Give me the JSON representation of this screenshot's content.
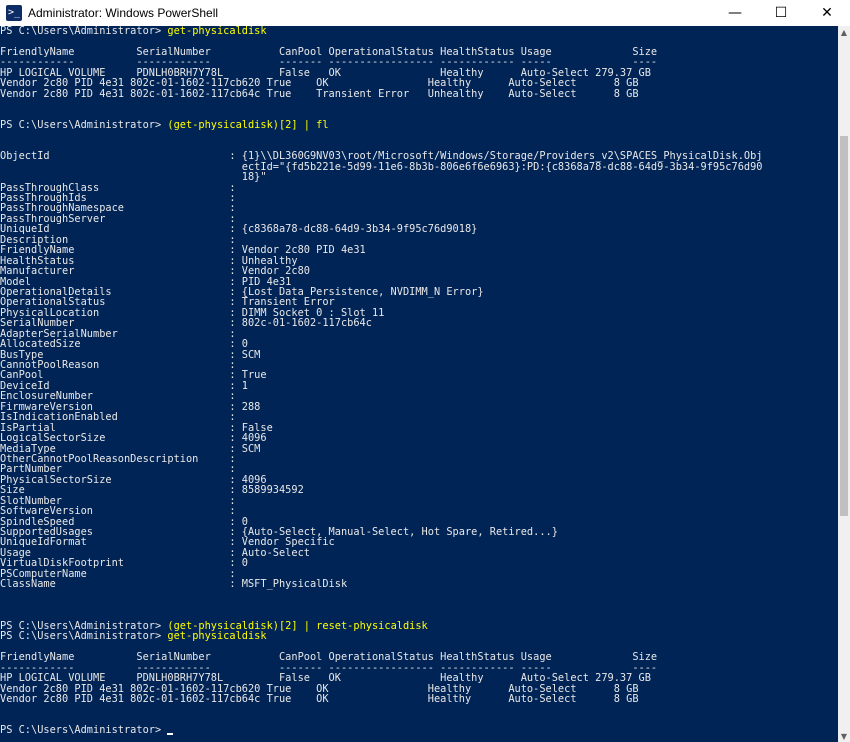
{
  "window": {
    "title": "Administrator: Windows PowerShell",
    "icon": "powershell-icon",
    "controls": {
      "minimize": "—",
      "maximize": "☐",
      "close": "✕"
    }
  },
  "console": {
    "lines": [
      [
        {
          "t": "PS C:\\Users\\Administrator> "
        },
        {
          "t": "get-physicaldisk",
          "c": "y"
        }
      ],
      [
        {
          "t": ""
        }
      ],
      [
        {
          "t": "FriendlyName          SerialNumber           CanPool OperationalStatus HealthStatus Usage             Size"
        }
      ],
      [
        {
          "t": "------------          ------------           ------- ----------------- ------------ -----             ----"
        }
      ],
      [
        {
          "t": "HP LOGICAL VOLUME     PDNLH0BRH7Y78L         False   OK                Healthy      Auto-Select 279.37 GB"
        }
      ],
      [
        {
          "t": "Vendor 2c80 PID 4e31 802c-01-1602-117cb620 True    OK                Healthy      Auto-Select      8 GB"
        }
      ],
      [
        {
          "t": "Vendor 2c80 PID 4e31 802c-01-1602-117cb64c True    Transient Error   Unhealthy    Auto-Select      8 GB"
        }
      ],
      [
        {
          "t": ""
        }
      ],
      [
        {
          "t": ""
        }
      ],
      [
        {
          "t": "PS C:\\Users\\Administrator> "
        },
        {
          "t": "(get-physicaldisk)[2] | fl",
          "c": "y"
        }
      ],
      [
        {
          "t": ""
        }
      ],
      [
        {
          "t": ""
        }
      ],
      [
        {
          "t": "ObjectId                             : {1}\\\\DL360G9NV03\\root/Microsoft/Windows/Storage/Providers_v2\\SPACES_PhysicalDisk.Obj"
        }
      ],
      [
        {
          "t": "                                       ectId=\"{fd5b221e-5d99-11e6-8b3b-806e6f6e6963}:PD:{c8368a78-dc88-64d9-3b34-9f95c76d90"
        }
      ],
      [
        {
          "t": "                                       18}\""
        }
      ],
      [
        {
          "t": "PassThroughClass                     :"
        }
      ],
      [
        {
          "t": "PassThroughIds                       :"
        }
      ],
      [
        {
          "t": "PassThroughNamespace                 :"
        }
      ],
      [
        {
          "t": "PassThroughServer                    :"
        }
      ],
      [
        {
          "t": "UniqueId                             : {c8368a78-dc88-64d9-3b34-9f95c76d9018}"
        }
      ],
      [
        {
          "t": "Description                          :"
        }
      ],
      [
        {
          "t": "FriendlyName                         : Vendor 2c80 PID 4e31"
        }
      ],
      [
        {
          "t": "HealthStatus                         : Unhealthy"
        }
      ],
      [
        {
          "t": "Manufacturer                         : Vendor 2c80"
        }
      ],
      [
        {
          "t": "Model                                : PID 4e31"
        }
      ],
      [
        {
          "t": "OperationalDetails                   : {Lost Data Persistence, NVDIMM_N Error}"
        }
      ],
      [
        {
          "t": "OperationalStatus                    : Transient Error"
        }
      ],
      [
        {
          "t": "PhysicalLocation                     : DIMM Socket 0 : Slot 11"
        }
      ],
      [
        {
          "t": "SerialNumber                         : 802c-01-1602-117cb64c"
        }
      ],
      [
        {
          "t": "AdapterSerialNumber                  :"
        }
      ],
      [
        {
          "t": "AllocatedSize                        : 0"
        }
      ],
      [
        {
          "t": "BusType                              : SCM"
        }
      ],
      [
        {
          "t": "CannotPoolReason                     :"
        }
      ],
      [
        {
          "t": "CanPool                              : True"
        }
      ],
      [
        {
          "t": "DeviceId                             : 1"
        }
      ],
      [
        {
          "t": "EnclosureNumber                      :"
        }
      ],
      [
        {
          "t": "FirmwareVersion                      : 288"
        }
      ],
      [
        {
          "t": "IsIndicationEnabled                  :"
        }
      ],
      [
        {
          "t": "IsPartial                            : False"
        }
      ],
      [
        {
          "t": "LogicalSectorSize                    : 4096"
        }
      ],
      [
        {
          "t": "MediaType                            : SCM"
        }
      ],
      [
        {
          "t": "OtherCannotPoolReasonDescription     :"
        }
      ],
      [
        {
          "t": "PartNumber                           :"
        }
      ],
      [
        {
          "t": "PhysicalSectorSize                   : 4096"
        }
      ],
      [
        {
          "t": "Size                                 : 8589934592"
        }
      ],
      [
        {
          "t": "SlotNumber                           :"
        }
      ],
      [
        {
          "t": "SoftwareVersion                      :"
        }
      ],
      [
        {
          "t": "SpindleSpeed                         : 0"
        }
      ],
      [
        {
          "t": "SupportedUsages                      : {Auto-Select, Manual-Select, Hot Spare, Retired...}"
        }
      ],
      [
        {
          "t": "UniqueIdFormat                       : Vendor Specific"
        }
      ],
      [
        {
          "t": "Usage                                : Auto-Select"
        }
      ],
      [
        {
          "t": "VirtualDiskFootprint                 : 0"
        }
      ],
      [
        {
          "t": "PSComputerName                       :"
        }
      ],
      [
        {
          "t": "ClassName                            : MSFT_PhysicalDisk"
        }
      ],
      [
        {
          "t": ""
        }
      ],
      [
        {
          "t": ""
        }
      ],
      [
        {
          "t": ""
        }
      ],
      [
        {
          "t": "PS C:\\Users\\Administrator> "
        },
        {
          "t": "(get-physicaldisk)[2] | reset-physicaldisk",
          "c": "y"
        }
      ],
      [
        {
          "t": "PS C:\\Users\\Administrator> "
        },
        {
          "t": "get-physicaldisk",
          "c": "y"
        }
      ],
      [
        {
          "t": ""
        }
      ],
      [
        {
          "t": "FriendlyName          SerialNumber           CanPool OperationalStatus HealthStatus Usage             Size"
        }
      ],
      [
        {
          "t": "------------          ------------           ------- ----------------- ------------ -----             ----"
        }
      ],
      [
        {
          "t": "HP LOGICAL VOLUME     PDNLH0BRH7Y78L         False   OK                Healthy      Auto-Select 279.37 GB"
        }
      ],
      [
        {
          "t": "Vendor 2c80 PID 4e31 802c-01-1602-117cb620 True    OK                Healthy      Auto-Select      8 GB"
        }
      ],
      [
        {
          "t": "Vendor 2c80 PID 4e31 802c-01-1602-117cb64c True    OK                Healthy      Auto-Select      8 GB"
        }
      ],
      [
        {
          "t": ""
        }
      ],
      [
        {
          "t": ""
        }
      ],
      [
        {
          "t": "PS C:\\Users\\Administrator> "
        },
        {
          "cursor": true
        }
      ]
    ]
  }
}
